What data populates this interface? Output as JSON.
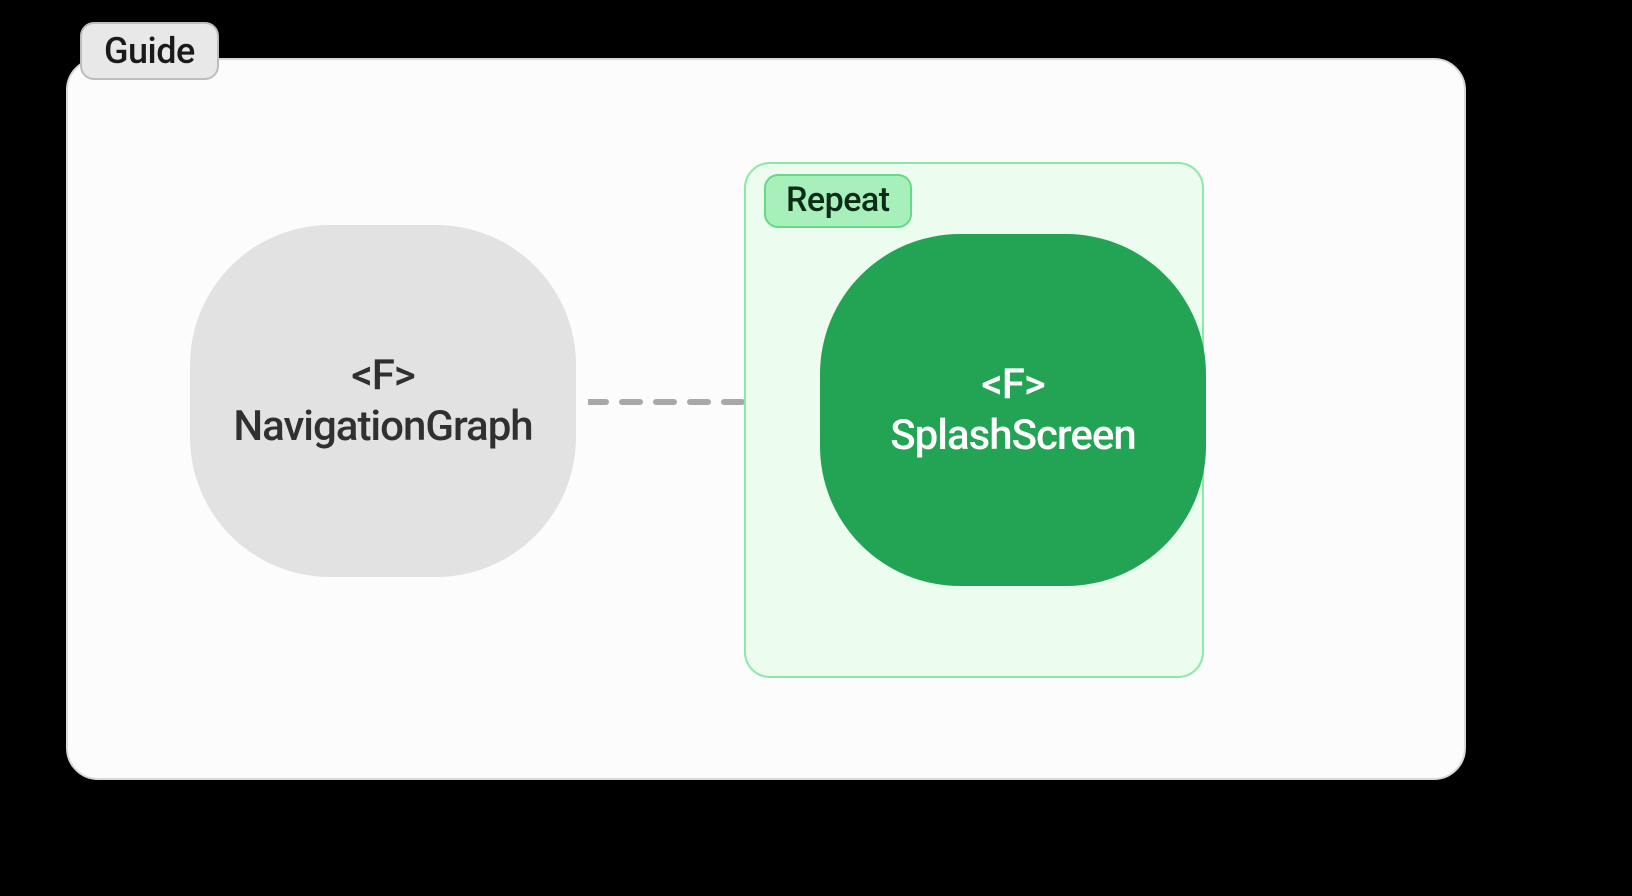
{
  "diagram": {
    "title_tag": "Guide",
    "source": {
      "stereotype": "<F>",
      "name": "NavigationGraph",
      "color": "#e2e2e2",
      "text_color": "#303030"
    },
    "target_container": {
      "tag": "Repeat",
      "border_color": "#8be9a6",
      "fill_color": "#ecfdf0"
    },
    "target": {
      "stereotype": "<F>",
      "name": "SplashScreen",
      "color": "#23a455",
      "text_color": "#ffffff"
    },
    "arrow": {
      "style": "dashed",
      "color": "#a8a8a8"
    }
  }
}
